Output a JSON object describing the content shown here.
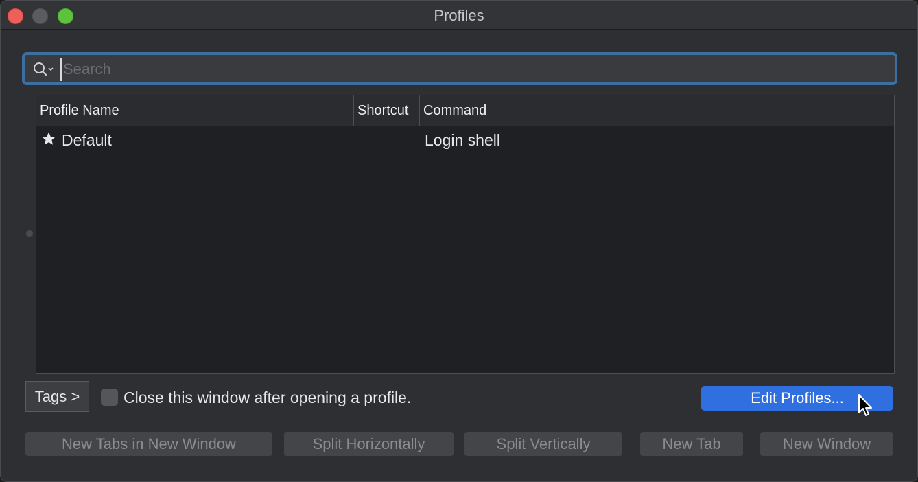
{
  "window": {
    "title": "Profiles"
  },
  "search": {
    "placeholder": "Search"
  },
  "table": {
    "columns": [
      "Profile Name",
      "Shortcut",
      "Command"
    ],
    "rows": [
      {
        "name": "Default",
        "shortcut": "",
        "command": "Login shell",
        "icon": "star-icon"
      }
    ]
  },
  "footer": {
    "tags_label": "Tags >",
    "close_checkbox_label": "Close this window after opening a profile.",
    "close_checkbox_checked": false,
    "edit_profiles_label": "Edit Profiles..."
  },
  "actions": [
    "New Tabs in New Window",
    "Split Horizontally",
    "Split Vertically",
    "New Tab",
    "New Window"
  ],
  "colors": {
    "accent": "#2f6fe0",
    "search_focus": "#3e6fa3",
    "close": "#ed5f58",
    "maximize": "#5fc23f"
  }
}
